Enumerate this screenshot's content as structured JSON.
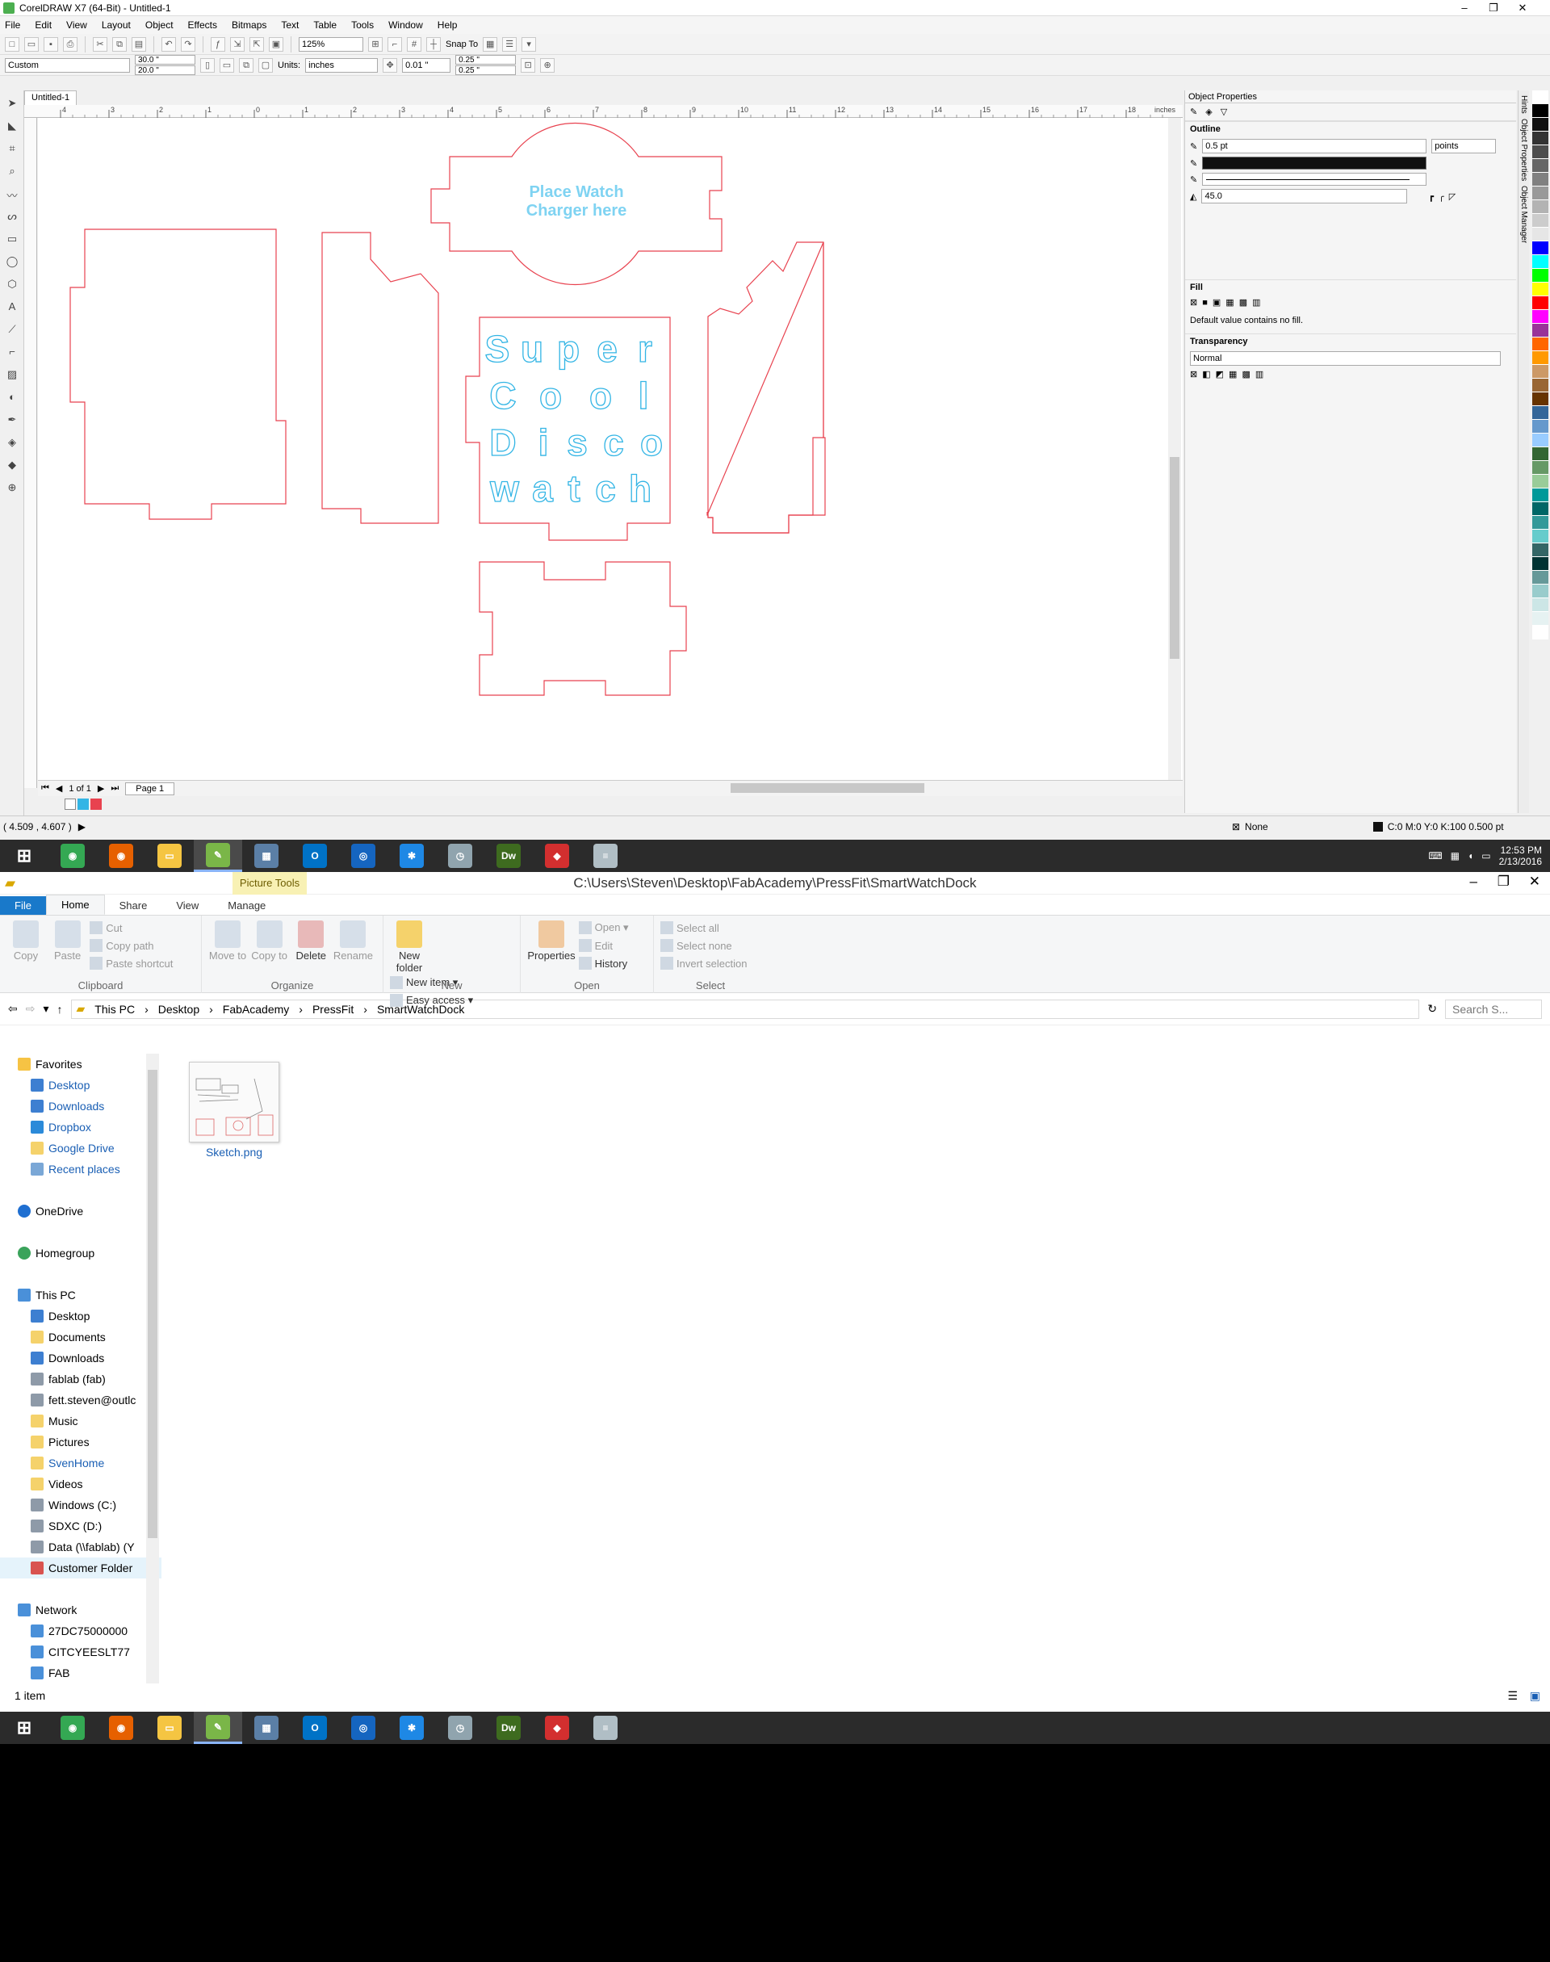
{
  "coreldraw": {
    "title": "CorelDRAW X7 (64-Bit) - Untitled-1",
    "menu": [
      "File",
      "Edit",
      "View",
      "Layout",
      "Object",
      "Effects",
      "Bitmaps",
      "Text",
      "Table",
      "Tools",
      "Window",
      "Help"
    ],
    "zoom": "125%",
    "snap_label": "Snap To",
    "page_size": "Custom",
    "width": "30.0 \"",
    "height": "20.0 \"",
    "units_label": "Units:",
    "units": "inches",
    "nudge": "0.01 \"",
    "dup_x": "0.25 \"",
    "dup_y": "0.25 \"",
    "doc_tab": "Untitled-1",
    "ruler_unit": "inches",
    "ruler_ticks": [
      "4",
      "3",
      "2",
      "1",
      "0",
      "1",
      "2",
      "3",
      "4",
      "5",
      "6",
      "7",
      "8",
      "9",
      "10",
      "11",
      "12",
      "13",
      "14",
      "15",
      "16",
      "17",
      "18"
    ],
    "page_counter": "1 of 1",
    "page_tab": "Page 1",
    "coords": "( 4.509 , 4.607 )",
    "status_fill": "None",
    "status_outline": "C:0 M:0 Y:0 K:100  0.500 pt",
    "design_text": {
      "charger_line1": "Place Watch",
      "charger_line2": "Charger here",
      "letters_row1": [
        "S",
        "u",
        "p",
        "e",
        "r"
      ],
      "letters_row2": [
        "C",
        "o",
        "o",
        "l"
      ],
      "letters_row3": [
        "D",
        "i",
        "s",
        "c",
        "o"
      ],
      "letters_row4": [
        "w",
        "a",
        "t",
        "c",
        "h"
      ]
    },
    "colors": {
      "cut_line": "#e8424f",
      "text_line": "#33b5e5"
    },
    "docker": {
      "title": "Object Properties",
      "outline_label": "Outline",
      "outline_width": "0.5 pt",
      "outline_units": "points",
      "miter": "45.0",
      "fill_label": "Fill",
      "fill_note": "Default value contains no fill.",
      "transparency_label": "Transparency",
      "transparency_mode": "Normal",
      "side_tabs": [
        "Hints",
        "Object Properties",
        "Object Manager"
      ]
    },
    "palette": [
      "#ffffff",
      "#000000",
      "#111111",
      "#333333",
      "#4d4d4d",
      "#666666",
      "#808080",
      "#999999",
      "#b3b3b3",
      "#cccccc",
      "#e6e6e6",
      "#0000ff",
      "#00ffff",
      "#00ff00",
      "#ffff00",
      "#ff0000",
      "#ff00ff",
      "#993399",
      "#ff6600",
      "#ff9900",
      "#cc9966",
      "#996633",
      "#663300",
      "#336699",
      "#6699cc",
      "#99ccff",
      "#336633",
      "#669966",
      "#99cc99",
      "#009999",
      "#006666",
      "#339999",
      "#66cccc",
      "#336666",
      "#003333",
      "#669999",
      "#99cccc",
      "#cce6e6",
      "#e6f2f2",
      "#ffffff"
    ]
  },
  "taskbar": {
    "apps": [
      {
        "name": "chrome",
        "color": "#34a853",
        "glyph": "◉"
      },
      {
        "name": "firefox",
        "color": "#e66000",
        "glyph": "◉"
      },
      {
        "name": "explorer",
        "color": "#f5c542",
        "glyph": "▭"
      },
      {
        "name": "coreldraw",
        "color": "#7ab648",
        "glyph": "✎"
      },
      {
        "name": "remote",
        "color": "#5b7fa6",
        "glyph": "▦"
      },
      {
        "name": "outlook",
        "color": "#0072c6",
        "glyph": "O"
      },
      {
        "name": "network",
        "color": "#1565c0",
        "glyph": "◎"
      },
      {
        "name": "pinwheel",
        "color": "#1e88e5",
        "glyph": "✱"
      },
      {
        "name": "time",
        "color": "#90a4ae",
        "glyph": "◷"
      },
      {
        "name": "dreamweaver",
        "color": "#3e6b1f",
        "glyph": "Dw"
      },
      {
        "name": "sketchup",
        "color": "#d32f2f",
        "glyph": "◆"
      },
      {
        "name": "notepad",
        "color": "#b0bec5",
        "glyph": "≡"
      }
    ],
    "time": "12:53 PM",
    "date": "2/13/2016"
  },
  "explorer": {
    "path_title": "C:\\Users\\Steven\\Desktop\\FabAcademy\\PressFit\\SmartWatchDock",
    "context_tab": "Picture Tools",
    "tabs": {
      "file": "File",
      "home": "Home",
      "share": "Share",
      "view": "View",
      "manage": "Manage"
    },
    "ribbon": {
      "copy": "Copy",
      "paste": "Paste",
      "cut": "Cut",
      "copy_path": "Copy path",
      "paste_shortcut": "Paste shortcut",
      "clipboard": "Clipboard",
      "move_to": "Move to",
      "copy_to": "Copy to",
      "delete": "Delete",
      "rename": "Rename",
      "organize": "Organize",
      "new_folder": "New folder",
      "new_item": "New item ▾",
      "easy_access": "Easy access ▾",
      "new": "New",
      "properties": "Properties",
      "open": "Open ▾",
      "edit": "Edit",
      "history": "History",
      "open_group": "Open",
      "select_all": "Select all",
      "select_none": "Select none",
      "invert_selection": "Invert selection",
      "select": "Select"
    },
    "breadcrumb": [
      "This PC",
      "Desktop",
      "FabAcademy",
      "PressFit",
      "SmartWatchDock"
    ],
    "search_placeholder": "Search S...",
    "nav": {
      "favorites": "Favorites",
      "favorites_items": [
        "Desktop",
        "Downloads",
        "Dropbox",
        "Google Drive",
        "Recent places"
      ],
      "onedrive": "OneDrive",
      "homegroup": "Homegroup",
      "thispc": "This PC",
      "thispc_items": [
        "Desktop",
        "Documents",
        "Downloads",
        "fablab (fab)",
        "fett.steven@outlc",
        "Music",
        "Pictures",
        "SvenHome",
        "Videos",
        "Windows (C:)",
        "SDXC (D:)",
        "Data (\\\\fablab) (Y",
        "Customer Folder"
      ],
      "network": "Network",
      "network_items": [
        "27DC75000000",
        "CITCYEESLT77",
        "FAB"
      ]
    },
    "file": {
      "name": "Sketch.png"
    },
    "status": "1 item"
  }
}
